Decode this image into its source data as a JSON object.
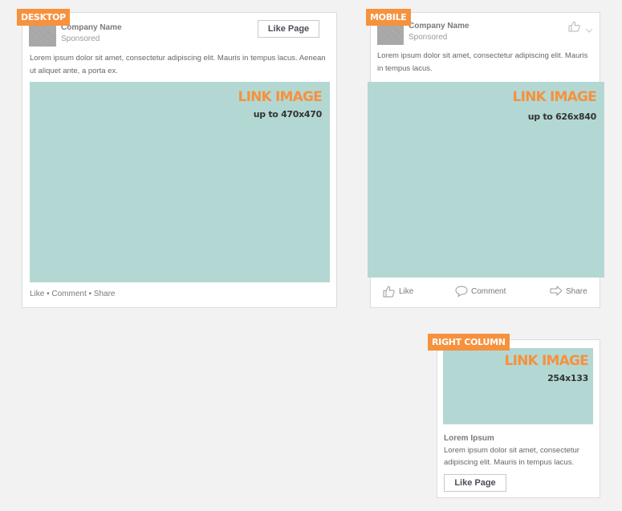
{
  "desktop": {
    "tag": "DESKTOP",
    "company_name": "Company Name",
    "sponsored": "Sponsored",
    "like_page": "Like Page",
    "body_text": "Lorem ipsum dolor sit amet, consectetur adipiscing elit. Mauris in tempus lacus. Aenean ut aliquet ante, a porta ex.",
    "link_image_title": "LINK IMAGE",
    "link_image_size": "up to 470x470",
    "footer": "Like • Comment • Share"
  },
  "mobile": {
    "tag": "MOBILE",
    "company_name": "Company Name",
    "sponsored": "Sponsored",
    "body_text": "Lorem ipsum dolor sit amet, consectetur adipiscing elit. Mauris in tempus lacus.",
    "link_image_title": "LINK IMAGE",
    "link_image_size": "up to 626x840",
    "actions": {
      "like": "Like",
      "comment": "Comment",
      "share": "Share"
    },
    "icons": {
      "header_like": "thumbs-up-icon",
      "header_menu": "chevron-down-icon",
      "like": "thumbs-up-icon",
      "comment": "speech-bubble-icon",
      "share": "share-arrow-icon"
    }
  },
  "right_column": {
    "tag": "RIGHT COLUMN",
    "link_image_title": "LINK IMAGE",
    "link_image_size": "254x133",
    "title": "Lorem Ipsum",
    "body_text": "Lorem ipsum dolor sit amet, consectetur adipiscing elit. Mauris in tempus lacus.",
    "like_page": "Like Page"
  },
  "colors": {
    "accent": "#f6913e",
    "image": "#b3d8d3",
    "background": "#f2f2f2"
  }
}
